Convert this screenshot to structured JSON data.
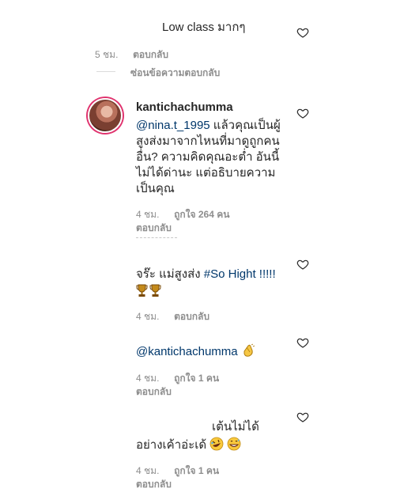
{
  "comment_top": {
    "text": "Low class มากๆ",
    "time": "5 ชม.",
    "reply_label": "ตอบกลับ",
    "hide_replies_label": "ซ่อนข้อความตอบกลับ"
  },
  "comment_main": {
    "username": "kantichachumma",
    "mention": "@nina.t_1995",
    "text_line1_rest": " แล้วคุณเป็นผู้",
    "text_line2": "สูงส่งมาจากไหนที่มาดูถูกคน",
    "text_line3": "อื่น? ความคิดคุณอะต่ำ อันนี้",
    "text_line4": "ไม่ได้ด่านะ แต่อธิบายความ",
    "text_line5": "เป็นคุณ",
    "time": "4 ชม.",
    "likes": "ถูกใจ 264 คน",
    "reply_label": "ตอบกลับ"
  },
  "reply1": {
    "text": "จร๊ะ แม่สูงส่ง ",
    "hashtag": "#So Hight !!!!!",
    "time": "4 ชม.",
    "reply_label": "ตอบกลับ",
    "emoji_names": [
      "trophy-emoji",
      "trophy-emoji"
    ]
  },
  "reply2": {
    "mention": "@kantichachumma",
    "emoji_name": "clapping-hands-emoji",
    "time": "4 ชม.",
    "likes": "ถูกใจ 1 คน",
    "reply_label": "ตอบกลับ"
  },
  "reply3": {
    "line1": "เต้นไม่ได้",
    "line2": "อย่างเค้าอ่ะเด้ ",
    "emoji_names": [
      "rolling-laughing-emoji",
      "grinning-sweat-emoji"
    ],
    "time": "4 ชม.",
    "likes": "ถูกใจ 1 คน",
    "reply_label": "ตอบกลับ"
  },
  "icons": {
    "like": "heart-outline-icon",
    "color_heart": "#262626",
    "color_avatar_ring": "#e0336e"
  }
}
